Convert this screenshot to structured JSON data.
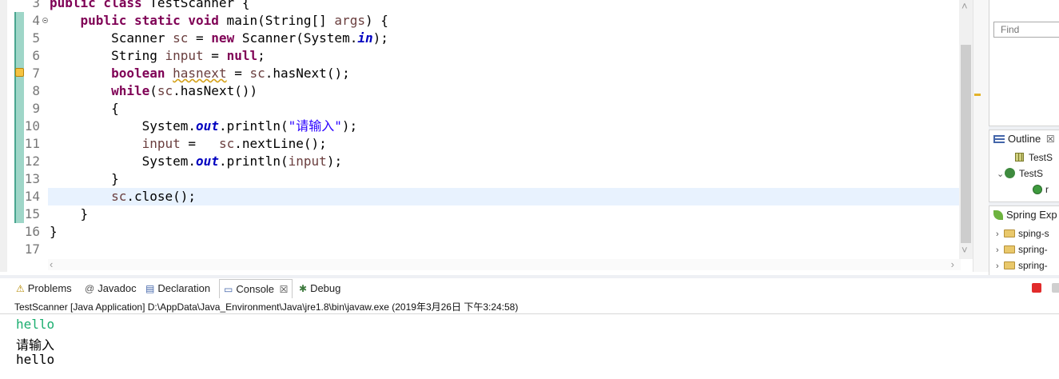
{
  "editor": {
    "lines": [
      {
        "num": "3",
        "tokens": [
          {
            "t": "public class",
            "c": "kw"
          },
          {
            "t": " TestScanner {"
          }
        ]
      },
      {
        "num": "4",
        "fold": true,
        "tokens": [
          {
            "t": "    "
          },
          {
            "t": "public static void",
            "c": "kw"
          },
          {
            "t": " main(String[] "
          },
          {
            "t": "args",
            "c": "var"
          },
          {
            "t": ") {"
          }
        ]
      },
      {
        "num": "5",
        "tokens": [
          {
            "t": "        Scanner "
          },
          {
            "t": "sc",
            "c": "var"
          },
          {
            "t": " = "
          },
          {
            "t": "new",
            "c": "kw"
          },
          {
            "t": " Scanner(System."
          },
          {
            "t": "in",
            "c": "fld"
          },
          {
            "t": ");"
          }
        ]
      },
      {
        "num": "6",
        "tokens": [
          {
            "t": "        String "
          },
          {
            "t": "input",
            "c": "var"
          },
          {
            "t": " = "
          },
          {
            "t": "null",
            "c": "kw"
          },
          {
            "t": ";"
          }
        ]
      },
      {
        "num": "7",
        "warning": true,
        "tokens": [
          {
            "t": "        "
          },
          {
            "t": "boolean",
            "c": "kw"
          },
          {
            "t": " "
          },
          {
            "t": "hasnext",
            "c": "var warn"
          },
          {
            "t": " = "
          },
          {
            "t": "sc",
            "c": "var"
          },
          {
            "t": ".hasNext();"
          }
        ]
      },
      {
        "num": "8",
        "tokens": [
          {
            "t": "        "
          },
          {
            "t": "while",
            "c": "kw"
          },
          {
            "t": "("
          },
          {
            "t": "sc",
            "c": "var"
          },
          {
            "t": ".hasNext())"
          }
        ]
      },
      {
        "num": "9",
        "tokens": [
          {
            "t": "        {"
          }
        ]
      },
      {
        "num": "10",
        "tokens": [
          {
            "t": "            System."
          },
          {
            "t": "out",
            "c": "fld"
          },
          {
            "t": ".println("
          },
          {
            "t": "\"请输入\"",
            "c": "str"
          },
          {
            "t": ");"
          }
        ]
      },
      {
        "num": "11",
        "tokens": [
          {
            "t": "            "
          },
          {
            "t": "input",
            "c": "var"
          },
          {
            "t": " =   "
          },
          {
            "t": "sc",
            "c": "var"
          },
          {
            "t": ".nextLine();"
          }
        ]
      },
      {
        "num": "12",
        "tokens": [
          {
            "t": "            System."
          },
          {
            "t": "out",
            "c": "fld"
          },
          {
            "t": ".println("
          },
          {
            "t": "input",
            "c": "var"
          },
          {
            "t": ");"
          }
        ]
      },
      {
        "num": "13",
        "tokens": [
          {
            "t": "        }"
          }
        ]
      },
      {
        "num": "14",
        "current": true,
        "tokens": [
          {
            "t": "        "
          },
          {
            "t": "sc",
            "c": "var"
          },
          {
            "t": ".close();"
          }
        ]
      },
      {
        "num": "15",
        "tokens": [
          {
            "t": "    }"
          }
        ]
      },
      {
        "num": "16",
        "tokens": [
          {
            "t": "}"
          }
        ]
      },
      {
        "num": "17",
        "tokens": []
      }
    ]
  },
  "right_panel": {
    "find_placeholder": "Find",
    "outline_tab": "Outline",
    "outline_close": "☒",
    "outline_items": [
      "TestS",
      "TestS",
      "r"
    ],
    "spring_tab": "Spring Exp",
    "spring_items": [
      "sping-s",
      "spring-",
      "spring-"
    ]
  },
  "console": {
    "tabs": [
      {
        "label": "Problems",
        "icon": "problems-icon",
        "glyph": "⚠"
      },
      {
        "label": "Javadoc",
        "icon": "javadoc-icon",
        "glyph": "@"
      },
      {
        "label": "Declaration",
        "icon": "declaration-icon",
        "glyph": "▤"
      },
      {
        "label": "Console",
        "icon": "console-icon",
        "glyph": "▭",
        "active": true,
        "close": "☒"
      },
      {
        "label": "Debug",
        "icon": "debug-icon",
        "glyph": "✱"
      }
    ],
    "description": "TestScanner [Java Application] D:\\AppData\\Java_Environment\\Java\\jre1.8\\bin\\javaw.exe (2019年3月26日 下午3:24:58)",
    "output": [
      {
        "text": "hello",
        "color": "#1aae6f"
      },
      {
        "text": "请输入",
        "color": "#000000"
      },
      {
        "text": "hello",
        "color": "#000000"
      }
    ]
  }
}
